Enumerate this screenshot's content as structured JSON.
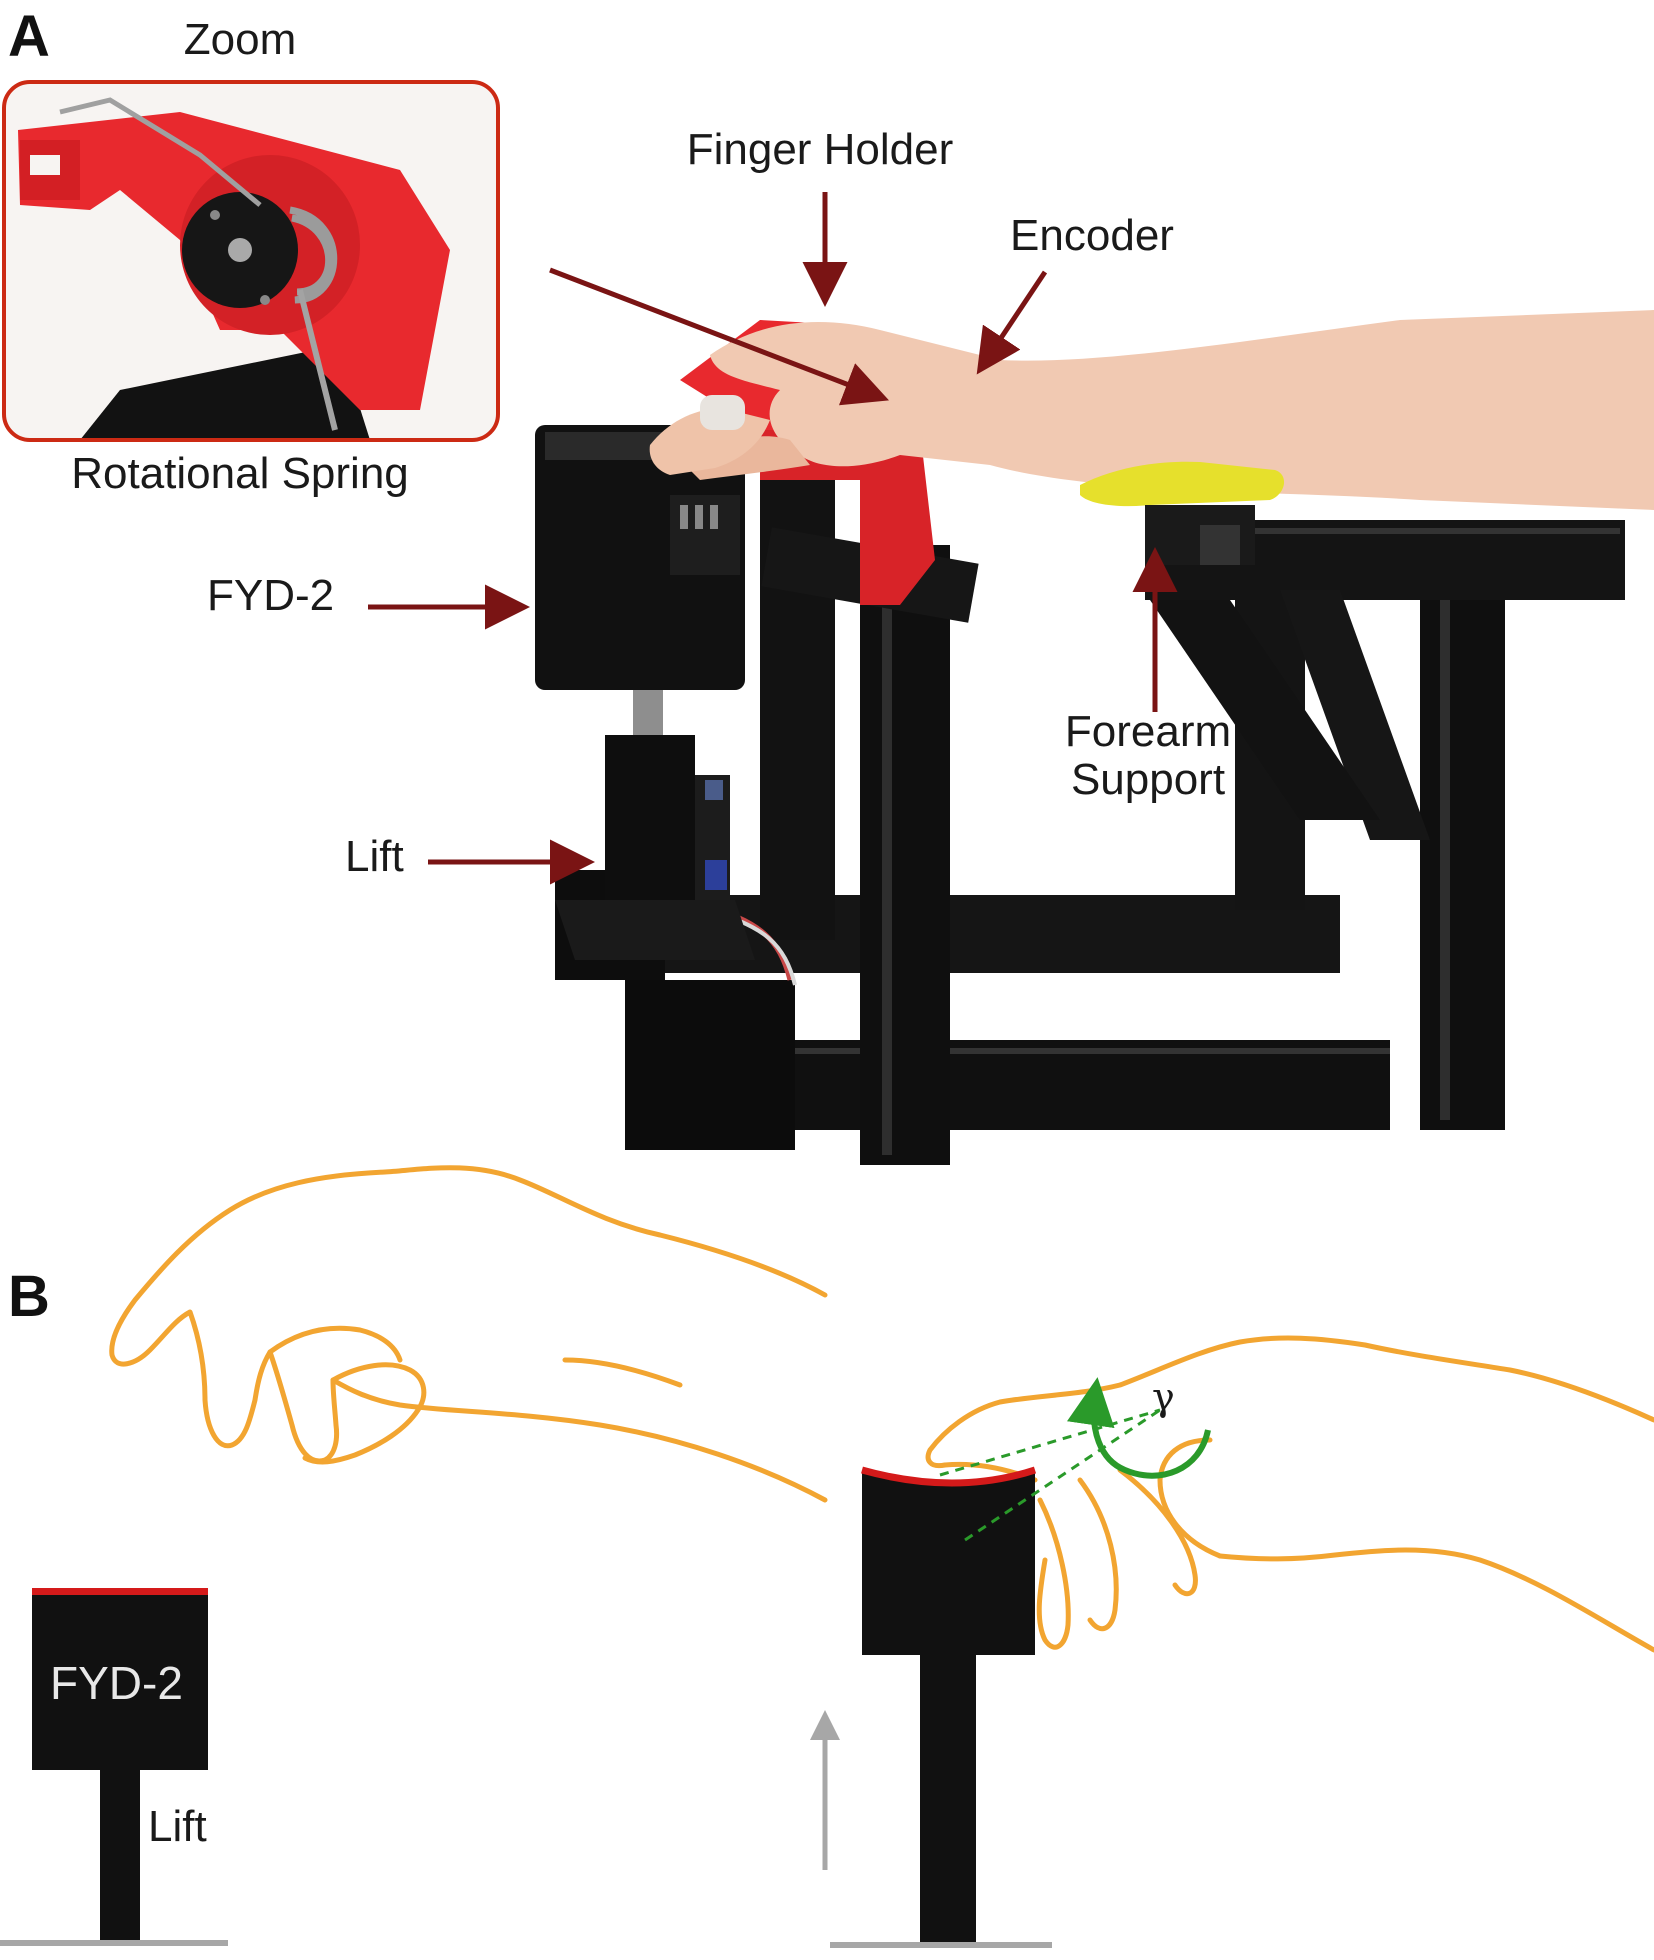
{
  "panels": {
    "a": "A",
    "b": "B"
  },
  "panel_a": {
    "zoom_title": "Zoom",
    "zoom_caption": "Rotational Spring",
    "finger_holder": "Finger Holder",
    "encoder": "Encoder",
    "fyd2": "FYD-2",
    "forearm_support_line1": "Forearm",
    "forearm_support_line2": "Support",
    "lift": "Lift"
  },
  "panel_b": {
    "fyd2_label": "FYD-2",
    "lift_label": "Lift",
    "angle_symbol": "γ"
  },
  "colors": {
    "arrow": "#7a1414",
    "hand_outline": "#f2a531",
    "contact_surface": "#d41a1a",
    "device": "#111111",
    "angle_lines": "#2a9a2a",
    "ground": "#a7a7a7",
    "device_red": "#e8292e",
    "forearm_pad": "#e6e02c",
    "skin": "#f1c9b2"
  }
}
